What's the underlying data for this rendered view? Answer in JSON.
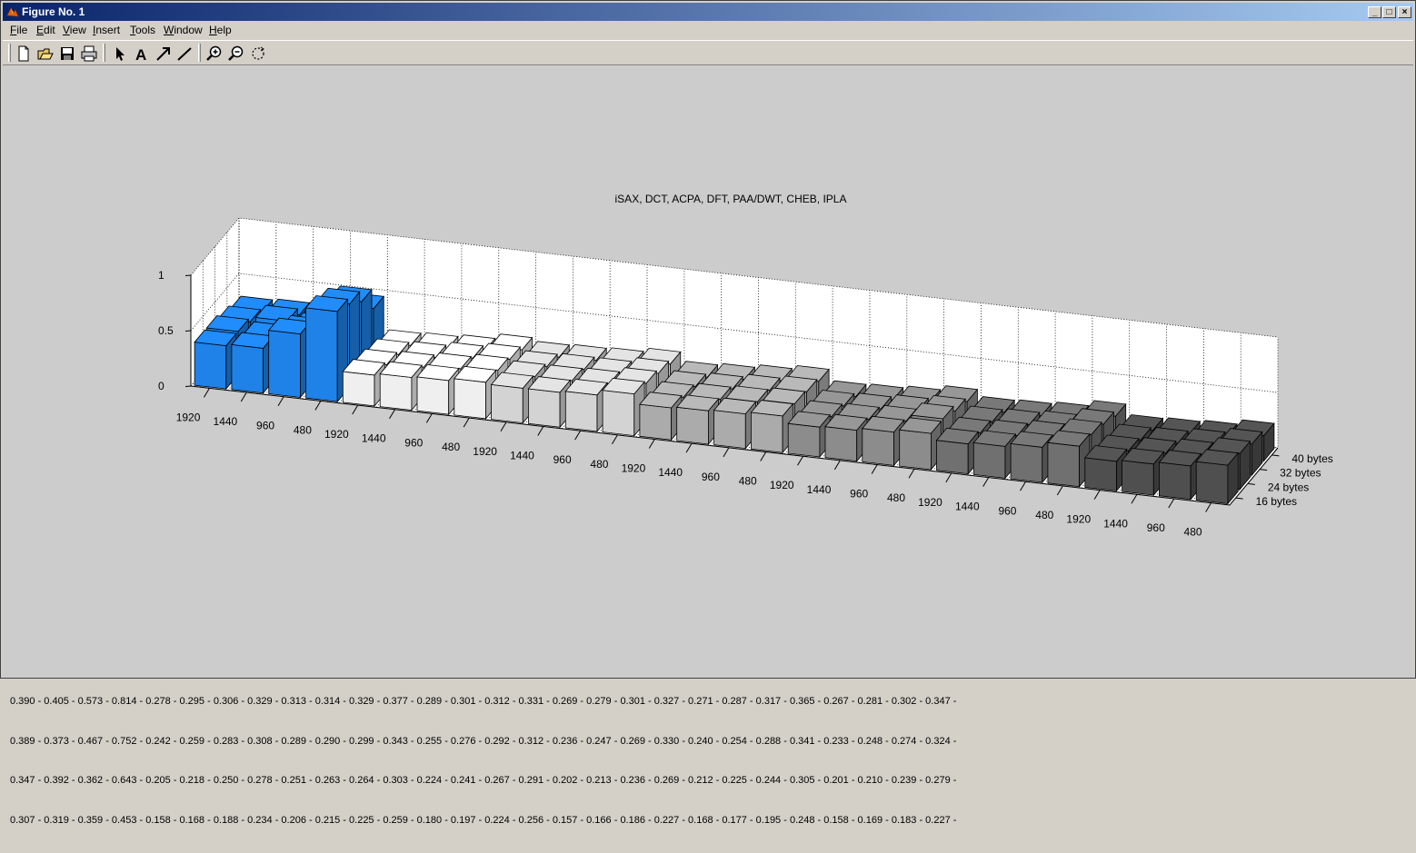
{
  "window": {
    "title": "Figure No. 1",
    "controls": {
      "minimize": "_",
      "maximize": "□",
      "close": "×"
    }
  },
  "menu": {
    "items": [
      {
        "label": "File",
        "hotkey": "F"
      },
      {
        "label": "Edit",
        "hotkey": "E"
      },
      {
        "label": "View",
        "hotkey": "V"
      },
      {
        "label": "Insert",
        "hotkey": "I"
      },
      {
        "label": "Tools",
        "hotkey": "T"
      },
      {
        "label": "Window",
        "hotkey": "W"
      },
      {
        "label": "Help",
        "hotkey": "H"
      }
    ]
  },
  "toolbar": {
    "buttons": [
      "new-figure-icon",
      "open-file-icon",
      "save-icon",
      "print-icon",
      "select-arrow-icon",
      "insert-text-icon",
      "insert-arrow-icon",
      "insert-line-icon",
      "zoom-in-icon",
      "zoom-out-icon",
      "rotate-3d-icon"
    ]
  },
  "chart_data": {
    "type": "bar3d",
    "title": "iSAX, DCT, ACPA, DFT, PAA/DWT, CHEB, IPLA",
    "zticks": [
      "0",
      "0.5",
      "1"
    ],
    "zlim": [
      0,
      1
    ],
    "x_tick_labels": [
      "1920",
      "1440",
      "960",
      "480",
      "1920",
      "1440",
      "960",
      "480",
      "1920",
      "1440",
      "960",
      "480",
      "1920",
      "1440",
      "960",
      "480",
      "1920",
      "1440",
      "960",
      "480",
      "1920",
      "1440",
      "960",
      "480",
      "1920",
      "1440",
      "960",
      "480"
    ],
    "y_tick_labels": [
      "40 bytes",
      "32 bytes",
      "24 bytes",
      "16 bytes"
    ],
    "group_colors": [
      "#1f82e8",
      "#efefef",
      "#d3d3d3",
      "#ababab",
      "#8c8c8c",
      "#707070",
      "#4f4f4f"
    ],
    "series": [
      {
        "name": "16 bytes",
        "values": [
          0.39,
          0.405,
          0.573,
          0.814,
          0.278,
          0.295,
          0.306,
          0.329,
          0.313,
          0.314,
          0.329,
          0.377,
          0.289,
          0.301,
          0.312,
          0.331,
          0.269,
          0.279,
          0.301,
          0.327,
          0.271,
          0.287,
          0.317,
          0.365,
          0.267,
          0.281,
          0.302,
          0.347
        ]
      },
      {
        "name": "24 bytes",
        "values": [
          0.389,
          0.373,
          0.467,
          0.752,
          0.242,
          0.259,
          0.283,
          0.308,
          0.289,
          0.29,
          0.299,
          0.343,
          0.255,
          0.276,
          0.292,
          0.312,
          0.236,
          0.247,
          0.269,
          0.33,
          0.24,
          0.254,
          0.288,
          0.341,
          0.233,
          0.248,
          0.274,
          0.324
        ]
      },
      {
        "name": "32 bytes",
        "values": [
          0.347,
          0.392,
          0.362,
          0.643,
          0.205,
          0.218,
          0.25,
          0.278,
          0.251,
          0.263,
          0.264,
          0.303,
          0.224,
          0.241,
          0.267,
          0.291,
          0.202,
          0.213,
          0.236,
          0.269,
          0.212,
          0.225,
          0.244,
          0.305,
          0.201,
          0.21,
          0.239,
          0.279
        ]
      },
      {
        "name": "40 bytes",
        "values": [
          0.307,
          0.319,
          0.359,
          0.453,
          0.158,
          0.168,
          0.188,
          0.234,
          0.206,
          0.215,
          0.225,
          0.259,
          0.18,
          0.197,
          0.224,
          0.256,
          0.157,
          0.166,
          0.186,
          0.227,
          0.168,
          0.177,
          0.195,
          0.248,
          0.158,
          0.169,
          0.183,
          0.227
        ]
      }
    ]
  },
  "data_rows": [
    "0.390 - 0.405 - 0.573 - 0.814 - 0.278 - 0.295 - 0.306 - 0.329 - 0.313 - 0.314 - 0.329 - 0.377 - 0.289 - 0.301 - 0.312 - 0.331 - 0.269 - 0.279 - 0.301 - 0.327 - 0.271 - 0.287 - 0.317 - 0.365 - 0.267 - 0.281 - 0.302 - 0.347 -",
    "0.389 - 0.373 - 0.467 - 0.752 - 0.242 - 0.259 - 0.283 - 0.308 - 0.289 - 0.290 - 0.299 - 0.343 - 0.255 - 0.276 - 0.292 - 0.312 - 0.236 - 0.247 - 0.269 - 0.330 - 0.240 - 0.254 - 0.288 - 0.341 - 0.233 - 0.248 - 0.274 - 0.324 -",
    "0.347 - 0.392 - 0.362 - 0.643 - 0.205 - 0.218 - 0.250 - 0.278 - 0.251 - 0.263 - 0.264 - 0.303 - 0.224 - 0.241 - 0.267 - 0.291 - 0.202 - 0.213 - 0.236 - 0.269 - 0.212 - 0.225 - 0.244 - 0.305 - 0.201 - 0.210 - 0.239 - 0.279 -",
    "0.307 - 0.319 - 0.359 - 0.453 - 0.158 - 0.168 - 0.188 - 0.234 - 0.206 - 0.215 - 0.225 - 0.259 - 0.180 - 0.197 - 0.224 - 0.256 - 0.157 - 0.166 - 0.186 - 0.227 - 0.168 - 0.177 - 0.195 - 0.248 - 0.158 - 0.169 - 0.183 - 0.227 -"
  ]
}
